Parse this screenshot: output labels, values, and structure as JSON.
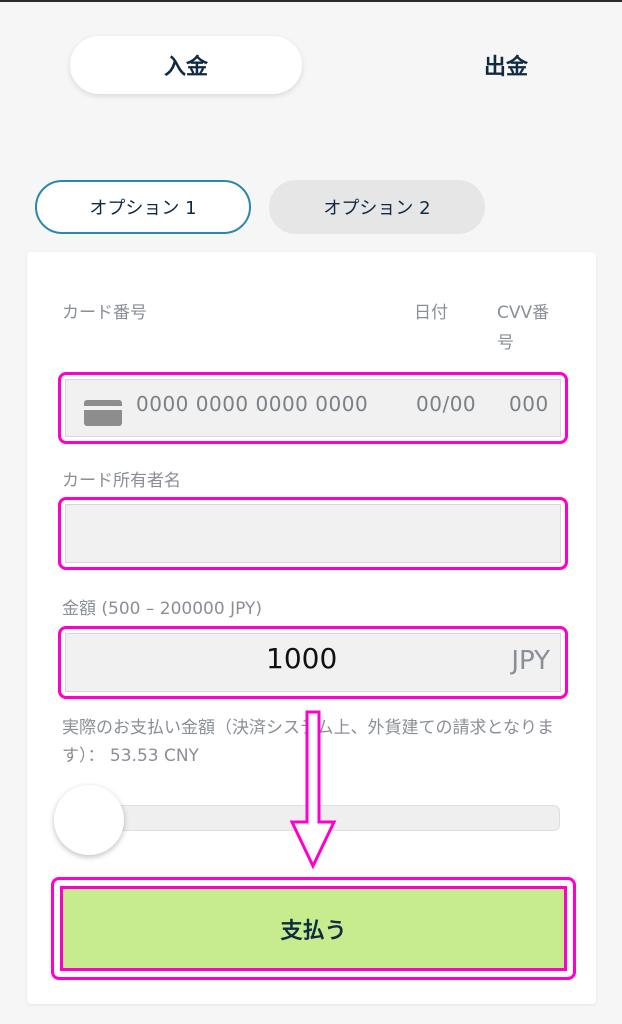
{
  "top_tabs": {
    "deposit": "入金",
    "withdraw": "出金"
  },
  "option_tabs": {
    "option1": "オプション 1",
    "option2": "オプション 2"
  },
  "card_section": {
    "card_number_label": "カード番号",
    "date_label": "日付",
    "cvv_label_line1": "CVV番",
    "cvv_label_line2": "号",
    "card_number_placeholder": "0000 0000 0000 0000",
    "date_placeholder": "00/00",
    "cvv_placeholder": "000"
  },
  "holder_section": {
    "label": "カード所有者名",
    "value": ""
  },
  "amount_section": {
    "label": "金額 (500 – 200000 JPY)",
    "value": "1000",
    "currency": "JPY"
  },
  "actual_amount_text": "実際のお支払い金額（決済システム上、外貨建ての請求となります）： 53.53 CNY",
  "slider": {
    "level": 0
  },
  "pay_button": {
    "label": "支払う"
  },
  "icons": [
    "credit-card-icon",
    "down-arrow-icon"
  ],
  "colors": {
    "highlight": "#ff00cc",
    "pay_button": "#c7ec8d",
    "active_border": "#2a87b0"
  }
}
